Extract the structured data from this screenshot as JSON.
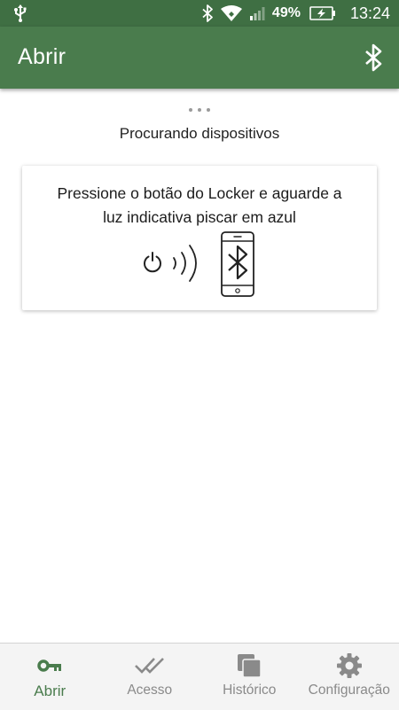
{
  "status_bar": {
    "battery_percent": "49%",
    "time": "13:24",
    "icons": [
      "usb-icon",
      "bluetooth-icon",
      "wifi-icon",
      "signal-icon",
      "battery-charging-icon"
    ]
  },
  "app_bar": {
    "title": "Abrir",
    "action_icon": "bluetooth-icon"
  },
  "main": {
    "status_text": "Procurando dispositivos",
    "card": {
      "instruction_line1": "Pressione o botão do Locker e aguarde a",
      "instruction_line2": "luz indicativa piscar em azul",
      "illustration_icons": [
        "power-icon",
        "signal-waves-icon",
        "phone-bluetooth-icon"
      ]
    }
  },
  "bottom_nav": {
    "items": [
      {
        "label": "Abrir",
        "icon": "key-icon",
        "active": true
      },
      {
        "label": "Acesso",
        "icon": "double-check-icon",
        "active": false
      },
      {
        "label": "Histórico",
        "icon": "history-icon",
        "active": false
      },
      {
        "label": "Configuração",
        "icon": "gear-icon",
        "active": false
      }
    ]
  },
  "colors": {
    "status_bar": "#3f6f43",
    "app_bar": "#4a7c4d",
    "accent": "#4a7c4d",
    "nav_inactive": "#8a8a8a"
  }
}
